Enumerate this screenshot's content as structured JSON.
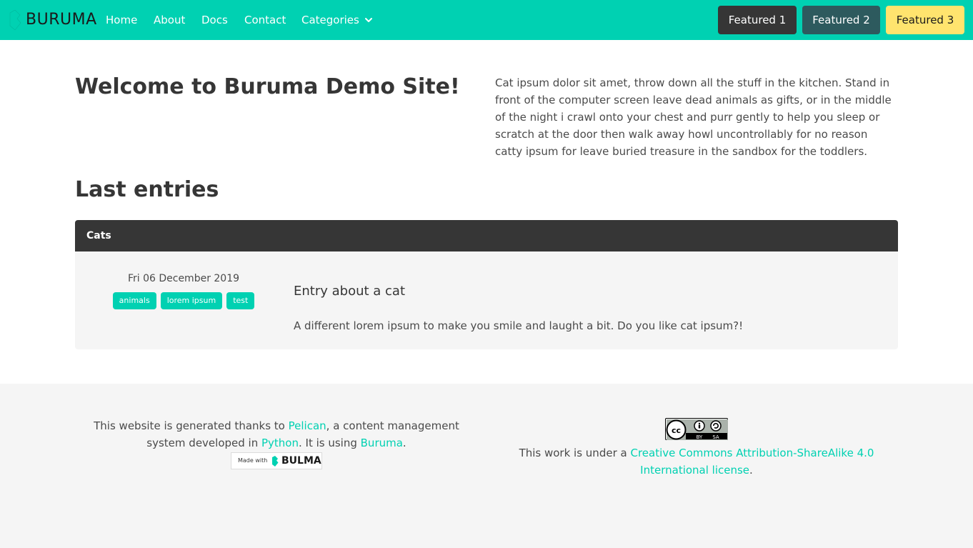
{
  "navbar": {
    "brand": "BURUMA",
    "links": [
      "Home",
      "About",
      "Docs",
      "Contact"
    ],
    "categories_label": "Categories",
    "featured": [
      "Featured 1",
      "Featured 2",
      "Featured 3"
    ]
  },
  "hero": {
    "title": "Welcome to Buruma Demo Site!",
    "intro": "Cat ipsum dolor sit amet, throw down all the stuff in the kitchen. Stand in front of the computer screen leave dead animals as gifts, or in the middle of the night i crawl onto your chest and purr gently to help you sleep or scratch at the door then walk away howl uncontrollably for no reason catty ipsum for leave buried treasure in the sandbox for the toddlers."
  },
  "entries": {
    "section_title": "Last entries",
    "category": "Cats",
    "entry": {
      "date": "Fri 06 December 2019",
      "tags": [
        "animals",
        "lorem ipsum",
        "test"
      ],
      "title": "Entry about a cat",
      "summary": "A different lorem ipsum to make you smile and laught a bit. Do you like cat ipsum?!"
    }
  },
  "footer": {
    "left_text_1": "This website is generated thanks to ",
    "pelican": "Pelican",
    "left_text_2": ", a content management system developed in ",
    "python": "Python",
    "left_text_3": ". It is using ",
    "buruma": "Buruma",
    "left_text_4": ".",
    "badge_made_with": "Made with",
    "badge_brand": "BULMA",
    "license_prefix": "This work is under a ",
    "license_link": "Creative Commons Attribution-ShareAlike 4.0 International license",
    "license_suffix": ".",
    "cc_by": "BY",
    "cc_sa": "SA"
  },
  "colors": {
    "primary": "#00d1b2",
    "dark": "#363636",
    "featured_2": "#2d5a5e",
    "featured_3": "#ffe46e"
  }
}
